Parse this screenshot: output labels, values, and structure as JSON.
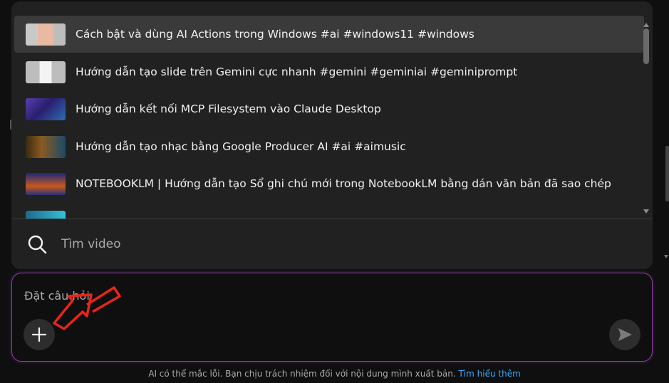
{
  "video_list": {
    "items": [
      {
        "title": "Cách bật và dùng AI Actions trong Windows #ai #windows11 #windows"
      },
      {
        "title": "Hướng dẫn tạo slide trên Gemini cực nhanh #gemini #geminiai #geminiprompt"
      },
      {
        "title": "Hướng dẫn kết nối MCP Filesystem vào Claude Desktop"
      },
      {
        "title": "Hướng dẫn tạo nhạc bằng Google Producer AI #ai #aimusic"
      },
      {
        "title": "NOTEBOOKLM | Hướng dẫn tạo Sổ ghi chú mới trong NotebookLM bằng dán văn bản đã sao chép"
      }
    ]
  },
  "search": {
    "placeholder": "Tìm video"
  },
  "ask": {
    "placeholder": "Đặt câu hỏi"
  },
  "footer": {
    "disclaimer": "AI có thể mắc lỗi. Bạn chịu trách nhiệm đối với nội dung mình xuất bản.",
    "link": "Tìm hiểu thêm"
  },
  "colors": {
    "accent_border": "#8e3fa8",
    "annotation_arrow": "#e8241a",
    "link": "#3ea6ff"
  },
  "icons": {
    "search": "search-icon",
    "add": "plus-icon",
    "send": "send-icon"
  }
}
